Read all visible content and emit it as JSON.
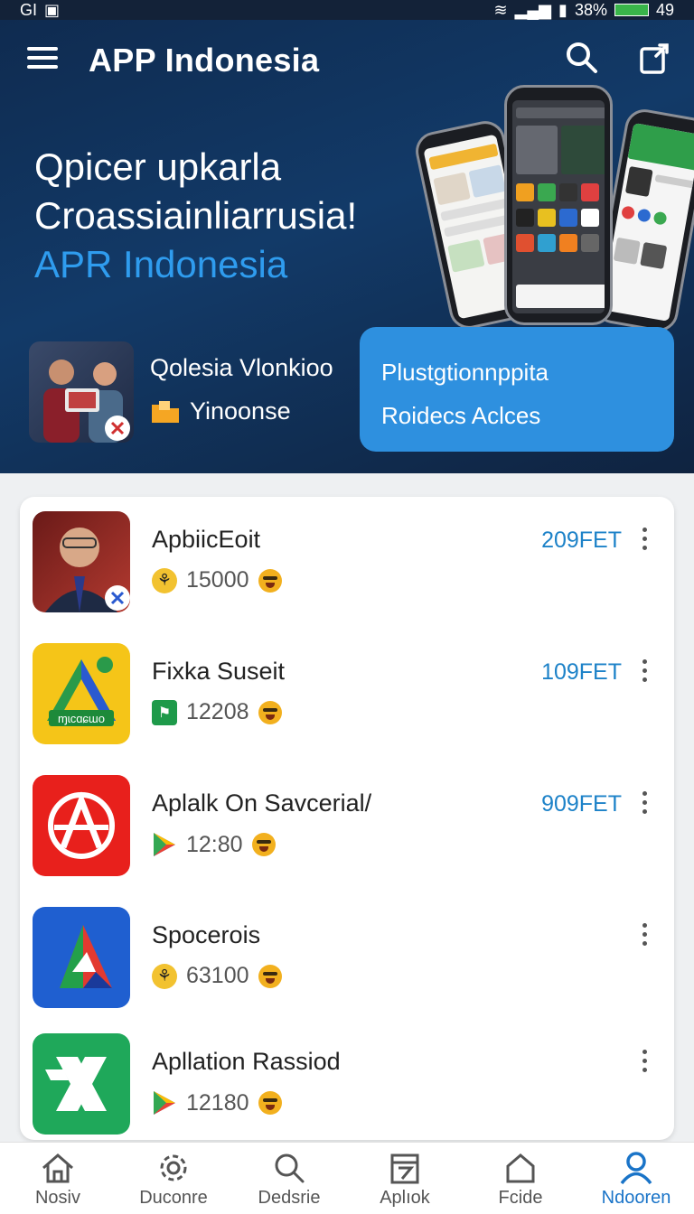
{
  "status_bar": {
    "left_text": "GI",
    "battery": "38%",
    "right_text": "49"
  },
  "header": {
    "title": "APP Indonesia"
  },
  "hero": {
    "line1": "Qpicer upkarla",
    "line2": "Croassiainliarrusia!",
    "line3": "APR Indonesia"
  },
  "profile": {
    "name": "Qolesia Vlonkioo",
    "subtitle": "Yinoonse"
  },
  "cta": {
    "line1": "Plustgtionnppita",
    "line2": "Roidecs Aclces"
  },
  "apps": [
    {
      "name": "ApbiicEoit",
      "count": "15000",
      "price": "209FET",
      "icon": "person-photo-icon",
      "meta_icon": "coin-icon"
    },
    {
      "name": "Fixka Suseit",
      "count": "12208",
      "price": "109FET",
      "icon": "triangle-logo-icon",
      "meta_icon": "flag-icon"
    },
    {
      "name": "Aplalk On Savcerial/",
      "count": "12:80",
      "price": "909FET",
      "icon": "a-circle-icon",
      "meta_icon": "play-store-icon"
    },
    {
      "name": "Spocerois",
      "count": "63100",
      "price": "",
      "icon": "arrow-logo-icon",
      "meta_icon": "coin-icon"
    },
    {
      "name": "Apllation Rassiod",
      "count": "12180",
      "price": "",
      "icon": "x-logo-icon",
      "meta_icon": "play-store-icon"
    }
  ],
  "nav": [
    {
      "label": "Nosiv",
      "icon": "home-icon"
    },
    {
      "label": "Duconre",
      "icon": "gear-icon"
    },
    {
      "label": "Dedsrie",
      "icon": "search-icon"
    },
    {
      "label": "Aplıok",
      "icon": "calendar-icon"
    },
    {
      "label": "Fcide",
      "icon": "house-outline-icon"
    },
    {
      "label": "Ndooren",
      "icon": "person-icon",
      "active": true
    }
  ],
  "colors": {
    "accent": "#2f9cee",
    "cta": "#2e90df",
    "price": "#1d82c8",
    "nav_active": "#1a74c8"
  }
}
